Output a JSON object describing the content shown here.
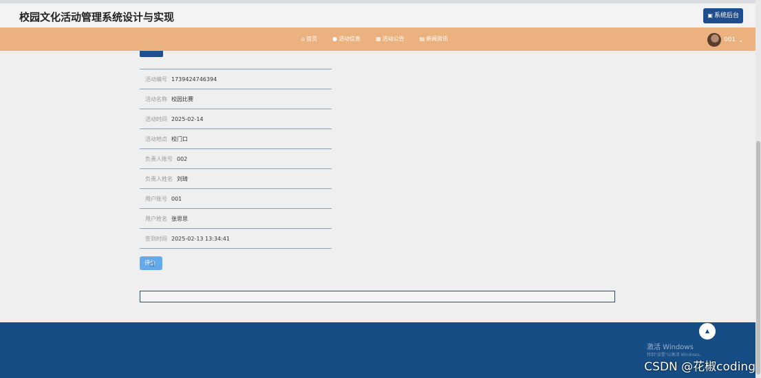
{
  "header": {
    "title": "校园文化活动管理系统设计与实现",
    "admin_button": "系统后台",
    "admin_icon": "dashboard-icon"
  },
  "nav": {
    "items": [
      {
        "label": "首页",
        "icon": "home-icon"
      },
      {
        "label": "活动信息",
        "icon": "info-icon"
      },
      {
        "label": "活动公告",
        "icon": "notice-icon"
      },
      {
        "label": "新闻资讯",
        "icon": "news-icon"
      }
    ],
    "user_name": "001"
  },
  "detail": {
    "rows": [
      {
        "label": "活动编号",
        "value": "1739424746394"
      },
      {
        "label": "活动名称",
        "value": "校园比赛"
      },
      {
        "label": "活动时间",
        "value": "2025-02-14"
      },
      {
        "label": "活动地点",
        "value": "校门口"
      },
      {
        "label": "负责人账号",
        "value": "002"
      },
      {
        "label": "负责人姓名",
        "value": "刘琦"
      },
      {
        "label": "用户账号",
        "value": "001"
      },
      {
        "label": "用户姓名",
        "value": "张思思"
      },
      {
        "label": "签到时间",
        "value": "2025-02-13 13:34:41"
      }
    ]
  },
  "actions": {
    "comment_button": "评价"
  },
  "overlay": {
    "windows_line1": "激活 Windows",
    "windows_line2": "转到\"设置\"以激活 Windows。",
    "watermark": "CSDN @花椒coding"
  },
  "colors": {
    "nav_bg": "#ebb17e",
    "footer_bg": "#164d85",
    "primary": "#1e4e8c"
  }
}
